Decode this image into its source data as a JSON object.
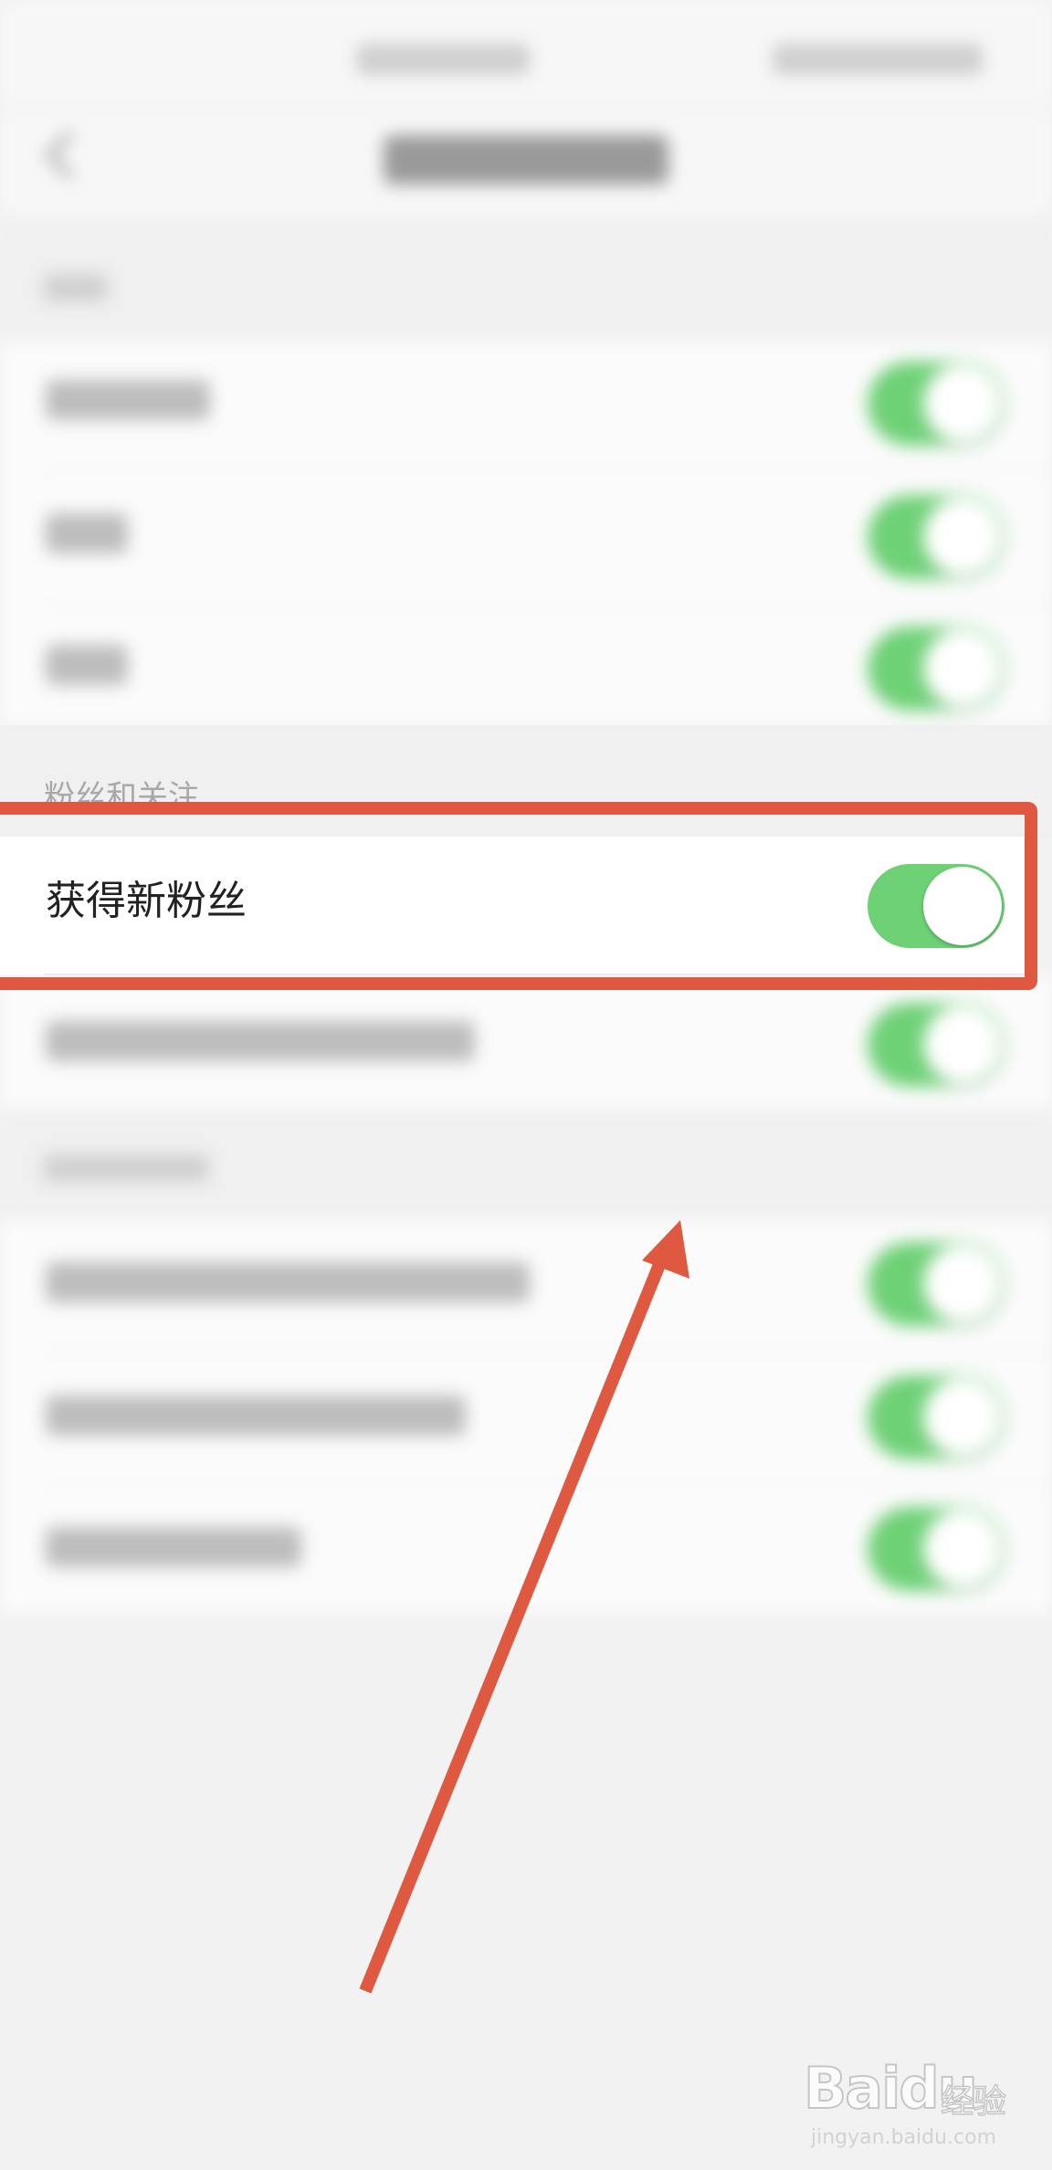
{
  "sections": {
    "fans": {
      "header": "粉丝和关注",
      "items": [
        {
          "label": "获得新粉丝",
          "enabled": true
        }
      ]
    }
  },
  "toggle_on_color": "#6ed176",
  "highlight_color": "#df5840",
  "watermark": {
    "brand": "Baidu",
    "cn": "经验",
    "url": "jingyan.baidu.com"
  },
  "icons": {
    "back": "chevron-left-icon"
  }
}
